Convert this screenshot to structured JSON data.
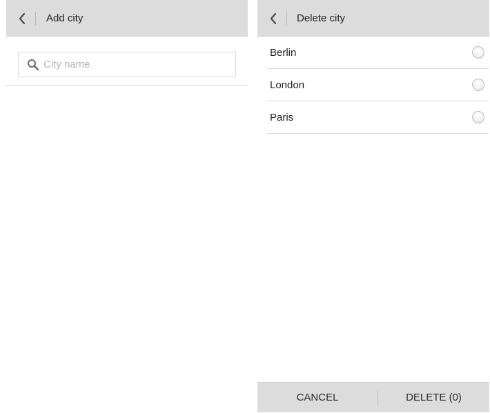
{
  "add_city": {
    "title": "Add city",
    "search": {
      "placeholder": "City name",
      "value": ""
    }
  },
  "delete_city": {
    "title": "Delete city",
    "cities": [
      {
        "name": "Berlin",
        "selected": false
      },
      {
        "name": "London",
        "selected": false
      },
      {
        "name": "Paris",
        "selected": false
      }
    ],
    "actions": {
      "cancel_label": "CANCEL",
      "delete_label": "DELETE (0)"
    }
  },
  "icons": {
    "back": "chevron-left-icon",
    "search": "magnifier-icon",
    "radio": "radio-unchecked-icon"
  },
  "colors": {
    "appbar_bg": "#dcdcdc",
    "divider": "#d6d6d6",
    "placeholder": "#b4b4b4",
    "text": "#1e1e1e"
  }
}
